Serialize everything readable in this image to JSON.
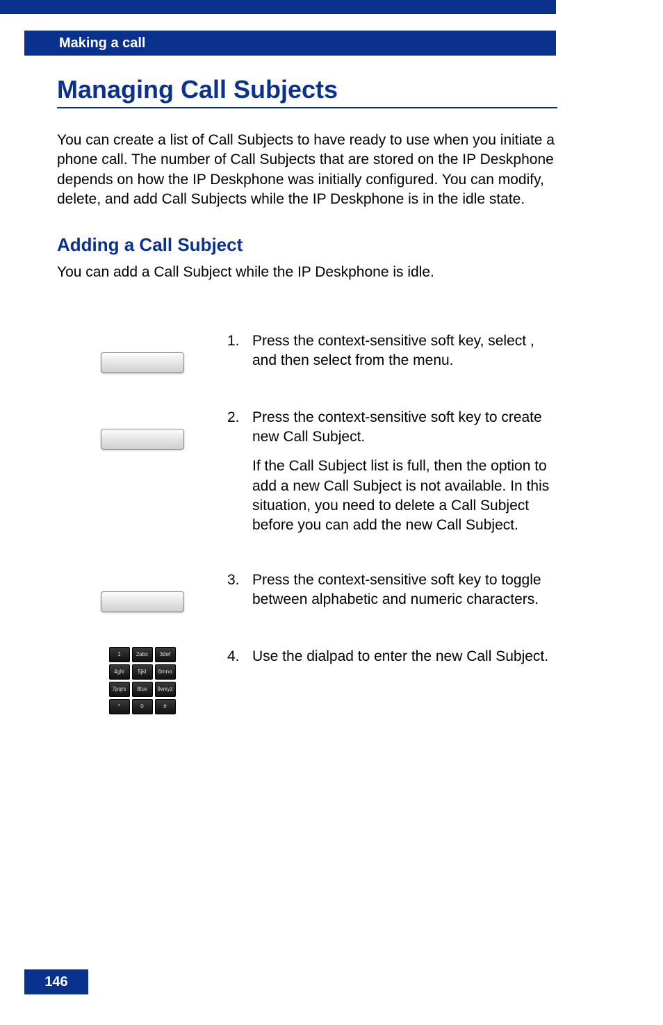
{
  "header": {
    "section": "Making a call"
  },
  "title": "Managing Call Subjects",
  "intro": "You can create a list of Call Subjects to have ready to use when you initiate a phone call. The number of Call Subjects that are stored on the IP Deskphone depends on how the IP Deskphone was initially configured. You can modify, delete, and add Call Subjects while the IP Deskphone is in the idle state.",
  "subheading": "Adding a Call Subject",
  "sub_intro": "You can add a Call Subject while the IP Deskphone is idle.",
  "steps": {
    "s1_num": "1.",
    "s1_a": "Press the ",
    "s1_b": " context-sensitive soft key, select ",
    "s1_c": ", and then select ",
    "s1_d": " from the menu.",
    "s2_num": "2.",
    "s2_a": "Press the ",
    "s2_b": " context-sensitive soft key to create new Call Subject.",
    "s2_note": " If the Call Subject list is full, then the option to add a new Call Subject is not available. In this situation, you need to delete a Call Subject before you can add the new Call Subject.",
    "s3_num": "3.",
    "s3_a": "Press the ",
    "s3_b": " context-sensitive soft key to toggle between alphabetic and numeric characters.",
    "s4_num": "4.",
    "s4_a": "Use the dialpad to enter the new Call Subject."
  },
  "dialpad": {
    "k1": "1",
    "k2": "2abc",
    "k3": "3def",
    "k4": "4ghi",
    "k5": "5jkl",
    "k6": "6mno",
    "k7": "7pqrs",
    "k8": "8tuv",
    "k9": "9wxyz",
    "k10": "*",
    "k11": "0",
    "k12": "#"
  },
  "footer": {
    "page_number": "146"
  }
}
